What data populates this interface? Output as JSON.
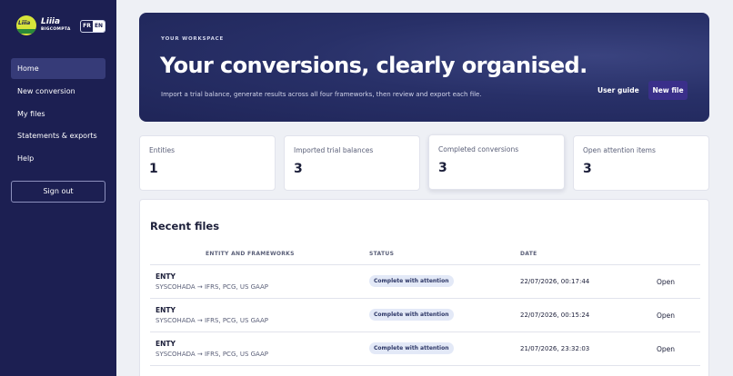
{
  "brand": {
    "name": "Liiia",
    "subtitle": "BIGCOMPTA",
    "logo_text": "Liiia",
    "lang_fr": "FR",
    "lang_en": "EN",
    "active_lang": "EN"
  },
  "sidebar": {
    "items": [
      {
        "label": "Home",
        "active": true
      },
      {
        "label": "New conversion",
        "active": false
      },
      {
        "label": "My files",
        "active": false
      },
      {
        "label": "Statements & exports",
        "active": false
      },
      {
        "label": "Help",
        "active": false
      }
    ],
    "signout_label": "Sign out"
  },
  "hero": {
    "kicker": "YOUR WORKSPACE",
    "title": "Your conversions, clearly organised.",
    "subtitle": "Import a trial balance, generate results across all four frameworks, then review and export each file.",
    "guide_label": "User guide",
    "new_file_label": "New file"
  },
  "stats": [
    {
      "label": "Entities",
      "value": "1"
    },
    {
      "label": "Imported trial balances",
      "value": "3"
    },
    {
      "label": "Completed conversions",
      "value": "3"
    },
    {
      "label": "Open attention items",
      "value": "3"
    }
  ],
  "recent": {
    "title": "Recent files",
    "columns": {
      "entity": "ENTITY AND FRAMEWORKS",
      "status": "STATUS",
      "date": "DATE"
    },
    "rows": [
      {
        "entity": "ENTY",
        "frameworks": "SYSCOHADA → IFRS, PCG, US GAAP",
        "status": "Complete with attention",
        "date": "22/07/2026, 00:17:44",
        "action": "Open"
      },
      {
        "entity": "ENTY",
        "frameworks": "SYSCOHADA → IFRS, PCG, US GAAP",
        "status": "Complete with attention",
        "date": "22/07/2026, 00:15:24",
        "action": "Open"
      },
      {
        "entity": "ENTY",
        "frameworks": "SYSCOHADA → IFRS, PCG, US GAAP",
        "status": "Complete with attention",
        "date": "21/07/2026, 23:32:03",
        "action": "Open"
      }
    ]
  },
  "colors": {
    "sidebar_bg": "#1c1f52",
    "hero_bg": "#283068",
    "accent_button": "#3a2f8a",
    "badge_bg": "#e3e9f7",
    "logo_yellow": "#d7e43a",
    "logo_green": "#2a8a3a"
  }
}
